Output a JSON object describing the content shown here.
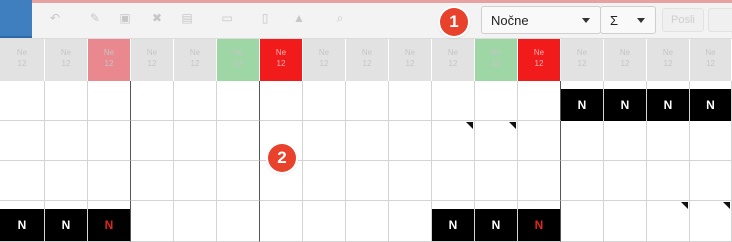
{
  "toolbar": {
    "shift_select": "Nočne",
    "sum_select": "Σ",
    "icons": [
      "home-icon",
      "undo-icon",
      "edit-icon",
      "copy-icon",
      "delete-icon",
      "print-icon",
      "document-icon",
      "warning-icon",
      "search-icon"
    ],
    "ghost_button": "Posli"
  },
  "callouts": [
    "1",
    "2"
  ],
  "header": {
    "day_abbr": "Ne",
    "day_num": "12",
    "colors": {
      "normal": "#e2e2e2",
      "weekend_purple": "#e9888f",
      "holiday_green": "#9fd6a6",
      "holiday_red": "#f21b1b"
    }
  },
  "grid": {
    "rows": [
      [
        "",
        "",
        "",
        "",
        "",
        "",
        "",
        "",
        "",
        "",
        "",
        "",
        "",
        "N",
        "N",
        "N",
        "N"
      ],
      [
        "",
        "",
        "",
        "",
        "",
        "",
        "",
        "",
        "",
        "",
        "",
        "",
        "",
        "",
        "",
        "",
        ""
      ],
      [
        "",
        "",
        "",
        "",
        "",
        "",
        "",
        "",
        "",
        "",
        "",
        "",
        "",
        "",
        "",
        "",
        ""
      ],
      [
        "N",
        "N",
        "N",
        "",
        "",
        "",
        "",
        "",
        "",
        "",
        "N",
        "N",
        "N",
        "",
        "",
        "",
        ""
      ]
    ],
    "shift_letter": "N"
  }
}
